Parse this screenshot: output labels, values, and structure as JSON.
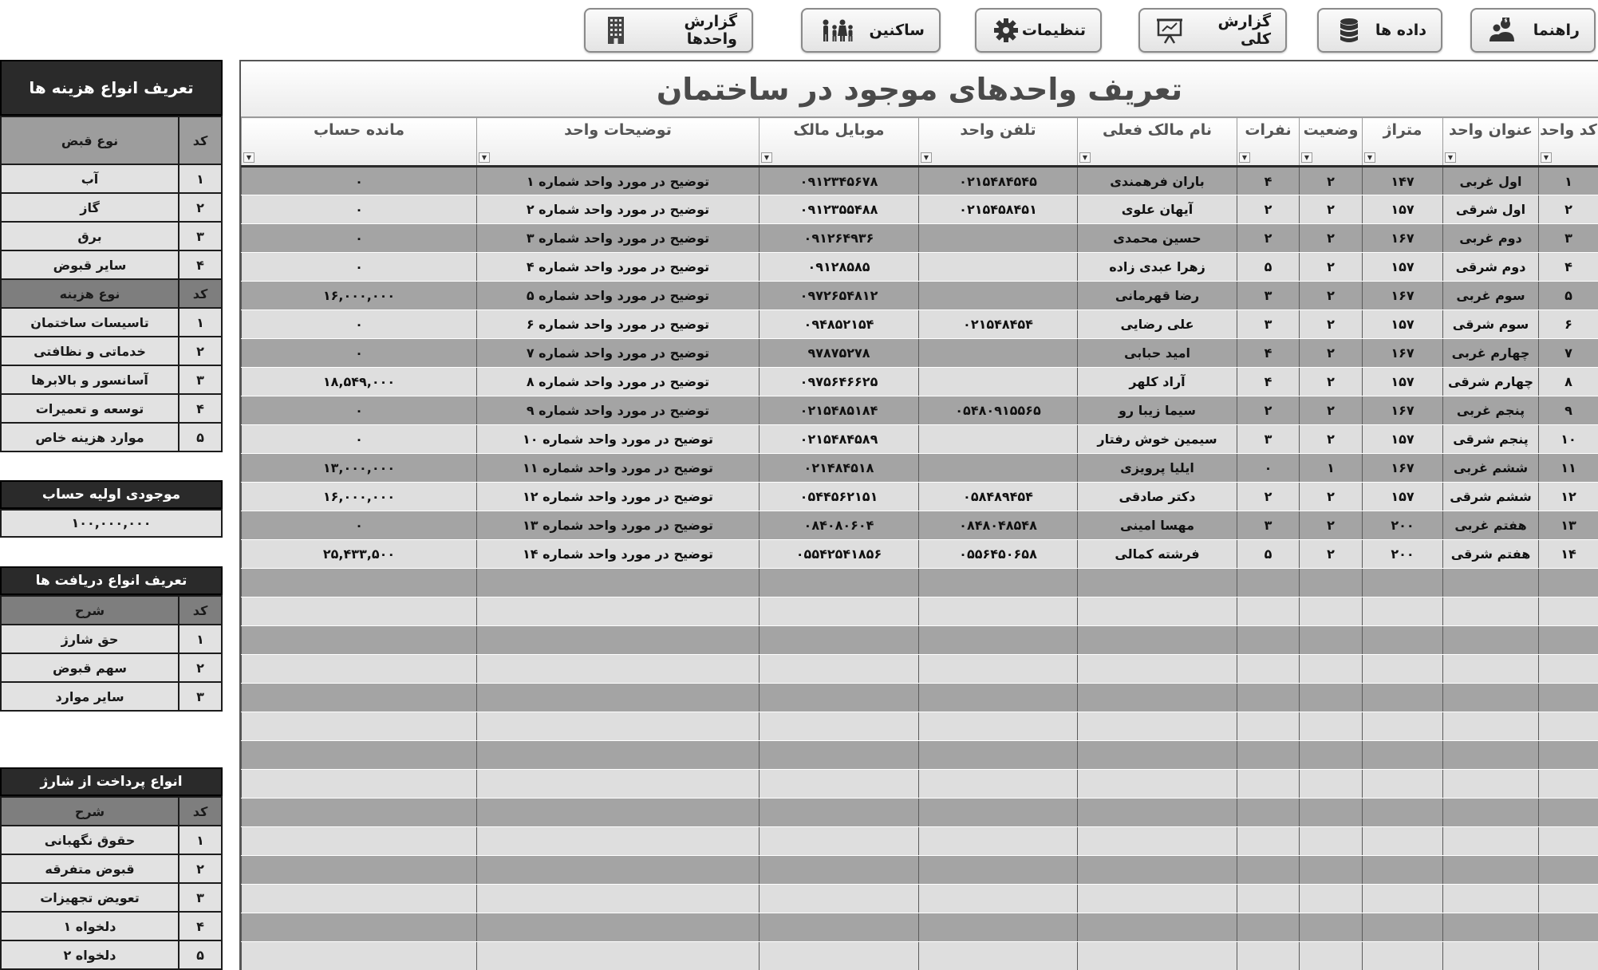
{
  "toolbar": {
    "guide": "راهنما",
    "data": "داده ها",
    "report_total": "گزارش کلی",
    "settings": "تنظیمات",
    "residents": "ساکنین",
    "units_report": "گزارش واحدها"
  },
  "side": {
    "expense_types": {
      "title": "تعریف انواع هزینه ها",
      "code_header": "کد",
      "bill_header": "نوع قبض",
      "bills": [
        {
          "code": "۱",
          "name": "آب"
        },
        {
          "code": "۲",
          "name": "گاز"
        },
        {
          "code": "۳",
          "name": "برق"
        },
        {
          "code": "۴",
          "name": "سایر قبوض"
        }
      ],
      "expense_header": "نوع هزینه",
      "expenses": [
        {
          "code": "۱",
          "name": "تاسیسات ساختمان"
        },
        {
          "code": "۲",
          "name": "خدماتی و نظافتی"
        },
        {
          "code": "۳",
          "name": "آسانسور و بالابرها"
        },
        {
          "code": "۴",
          "name": "توسعه و تعمیرات"
        },
        {
          "code": "۵",
          "name": "موارد هزینه خاص"
        }
      ]
    },
    "initial_balance": {
      "title": "موجودی اولیه حساب",
      "value": "۱۰۰,۰۰۰,۰۰۰"
    },
    "receipt_types": {
      "title": "تعریف انواع دریافت ها",
      "code_header": "کد",
      "desc_header": "شرح",
      "items": [
        {
          "code": "۱",
          "name": "حق شارژ"
        },
        {
          "code": "۲",
          "name": "سهم قبوض"
        },
        {
          "code": "۳",
          "name": "سایر موارد"
        }
      ]
    },
    "payment_types": {
      "title": "انواع پرداخت از شارژ",
      "code_header": "کد",
      "desc_header": "شرح",
      "items": [
        {
          "code": "۱",
          "name": "حقوق نگهبانی"
        },
        {
          "code": "۲",
          "name": "قبوض متفرقه"
        },
        {
          "code": "۳",
          "name": "تعویض تجهیزات"
        },
        {
          "code": "۴",
          "name": "دلخواه ۱"
        },
        {
          "code": "۵",
          "name": "دلخواه ۲"
        }
      ]
    }
  },
  "main": {
    "title": "تعریف واحدهای موجود در ساختمان",
    "columns": [
      "کد واحد",
      "عنوان واحد",
      "متراژ",
      "وضعیت",
      "نفرات",
      "نام مالک فعلی",
      "تلفن واحد",
      "موبایل مالک",
      "توضیحات واحد",
      "مانده حساب"
    ],
    "rows": [
      [
        "۱",
        "اول غربی",
        "۱۴۷",
        "۲",
        "۴",
        "باران فرهمندی",
        "۰۲۱۵۴۸۴۵۴۵",
        "۰۹۱۲۳۴۵۶۷۸",
        "توضیح در مورد واحد شماره ۱",
        "۰"
      ],
      [
        "۲",
        "اول شرقی",
        "۱۵۷",
        "۲",
        "۲",
        "آیهان علوی",
        "۰۲۱۵۴۵۸۴۵۱",
        "۰۹۱۲۳۵۵۴۸۸",
        "توضیح در مورد واحد شماره ۲",
        "۰"
      ],
      [
        "۳",
        "دوم غربی",
        "۱۶۷",
        "۲",
        "۲",
        "حسین محمدی",
        "",
        "۰۹۱۲۶۴۹۳۶",
        "توضیح در مورد واحد شماره ۳",
        "۰"
      ],
      [
        "۴",
        "دوم شرقی",
        "۱۵۷",
        "۲",
        "۵",
        "زهرا عبدی زاده",
        "",
        "۰۹۱۲۸۵۸۵",
        "توضیح در مورد واحد شماره ۴",
        "۰"
      ],
      [
        "۵",
        "سوم غربی",
        "۱۶۷",
        "۲",
        "۳",
        "رضا قهرمانی",
        "",
        "۰۹۷۲۶۵۴۸۱۲",
        "توضیح در مورد واحد شماره ۵",
        "۱۶,۰۰۰,۰۰۰"
      ],
      [
        "۶",
        "سوم شرقی",
        "۱۵۷",
        "۲",
        "۳",
        "علی رضایی",
        "۰۲۱۵۴۸۴۵۴",
        "۰۹۴۸۵۲۱۵۴",
        "توضیح در مورد واحد شماره ۶",
        "۰"
      ],
      [
        "۷",
        "چهارم غربی",
        "۱۶۷",
        "۲",
        "۴",
        "امید حبابی",
        "",
        "۹۷۸۷۵۲۷۸",
        "توضیح در مورد واحد شماره ۷",
        "۰"
      ],
      [
        "۸",
        "چهارم شرقی",
        "۱۵۷",
        "۲",
        "۴",
        "آراد کلهر",
        "",
        "۰۹۷۵۶۴۶۶۲۵",
        "توضیح در مورد واحد شماره ۸",
        "۱۸,۵۴۹,۰۰۰"
      ],
      [
        "۹",
        "پنجم غربی",
        "۱۶۷",
        "۲",
        "۲",
        "سیما زیبا رو",
        "۰۵۴۸۰۹۱۵۵۶۵",
        "۰۲۱۵۴۸۵۱۸۴",
        "توضیح در مورد واحد شماره ۹",
        "۰"
      ],
      [
        "۱۰",
        "پنجم شرقی",
        "۱۵۷",
        "۲",
        "۳",
        "سیمین خوش رفتار",
        "",
        "۰۲۱۵۴۸۴۵۸۹",
        "توضیح در مورد واحد شماره ۱۰",
        "۰"
      ],
      [
        "۱۱",
        "ششم غربی",
        "۱۶۷",
        "۱",
        "۰",
        "ایلیا پرویزی",
        "",
        "۰۲۱۴۸۴۵۱۸",
        "توضیح در مورد واحد شماره ۱۱",
        "۱۳,۰۰۰,۰۰۰"
      ],
      [
        "۱۲",
        "ششم شرقی",
        "۱۵۷",
        "۲",
        "۲",
        "دکتر صادقی",
        "۰۵۸۴۸۹۴۵۴",
        "۰۵۴۴۵۶۲۱۵۱",
        "توضیح در مورد واحد شماره ۱۲",
        "۱۶,۰۰۰,۰۰۰"
      ],
      [
        "۱۳",
        "هفتم غربی",
        "۲۰۰",
        "۲",
        "۳",
        "مهسا امینی",
        "۰۸۴۸۰۴۸۵۴۸",
        "۰۸۴۰۸۰۶۰۴",
        "توضیح در مورد واحد شماره ۱۳",
        "۰"
      ],
      [
        "۱۴",
        "هفتم شرقی",
        "۲۰۰",
        "۲",
        "۵",
        "فرشته کمالی",
        "۰۵۵۶۴۵۰۶۵۸",
        "۰۵۵۴۲۵۴۱۸۵۶",
        "توضیح در مورد واحد شماره ۱۴",
        "۲۵,۴۳۳,۵۰۰"
      ]
    ]
  },
  "icons": [
    "users-icon",
    "database-icon",
    "presentation-icon",
    "gear-icon",
    "family-icon",
    "building-icon",
    "filter-dropdown-icon"
  ]
}
